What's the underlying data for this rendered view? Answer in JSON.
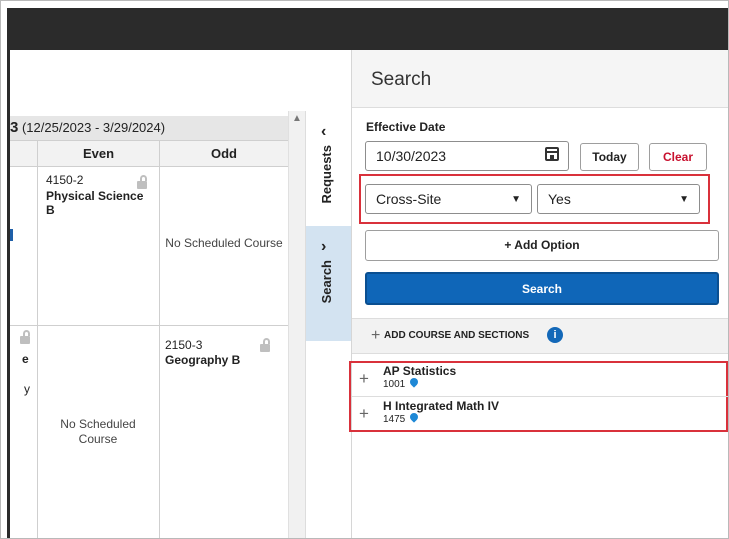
{
  "schedule": {
    "term_number": "3",
    "term_dates": "(12/25/2023 - 3/29/2024)",
    "columns": [
      "Even",
      "Odd"
    ],
    "cells": {
      "even_row1_code": "4150-2",
      "even_row1_name": "Physical Science B",
      "odd_row1_text": "No Scheduled Course",
      "even_row2_text": "No Scheduled Course",
      "odd_row2_code": "2150-3",
      "odd_row2_name": "Geography B",
      "partial_row2_left": "e",
      "partial_row2_left2": "y"
    }
  },
  "tabs": {
    "requests": "Requests",
    "search": "Search"
  },
  "panel": {
    "title": "Search",
    "effective_date_label": "Effective Date",
    "effective_date_value": "10/30/2023",
    "today_label": "Today",
    "clear_label": "Clear",
    "filter_option": "Cross-Site",
    "filter_value": "Yes",
    "add_option_label": "+ Add Option",
    "search_label": "Search",
    "section_header": "ADD COURSE AND SECTIONS",
    "info_symbol": "i",
    "courses": [
      {
        "name": "AP Statistics",
        "number": "1001"
      },
      {
        "name": "H Integrated Math IV",
        "number": "1475"
      }
    ]
  },
  "colors": {
    "accent": "#0f66b8",
    "highlight_border": "#d9313b",
    "clear_text": "#c8102e",
    "search_tab_bg": "#d3e3f1"
  },
  "icons": [
    "calendar-icon",
    "chevron-left-icon",
    "chevron-right-icon",
    "lock-icon",
    "plus-icon",
    "info-icon",
    "location-pin-icon",
    "dropdown-arrow-icon"
  ]
}
